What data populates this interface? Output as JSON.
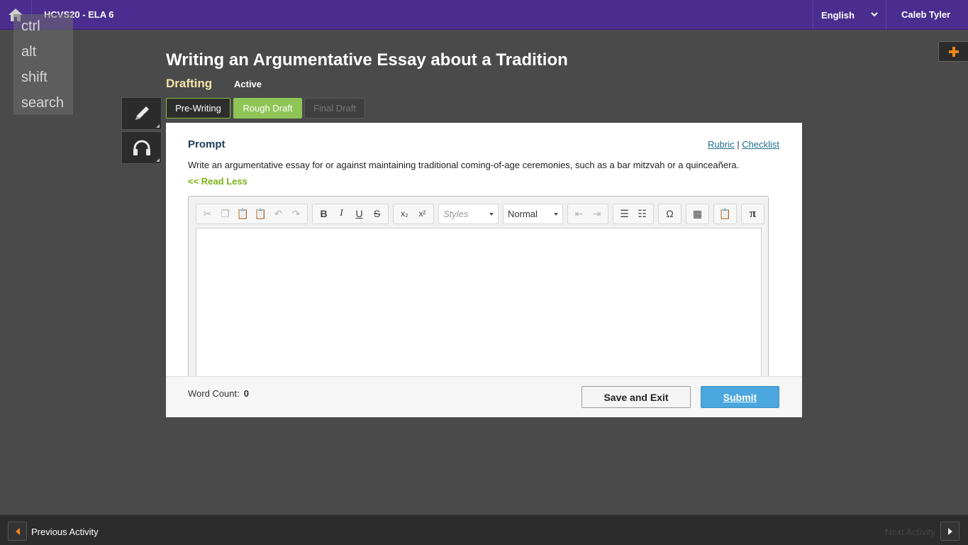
{
  "header": {
    "course_title": "HCVS20 - ELA 6",
    "language": "English",
    "user_name": "Caleb Tyler"
  },
  "keyboard_overlay": [
    "ctrl",
    "alt",
    "shift",
    "search"
  ],
  "activity": {
    "title": "Writing an Argumentative Essay about a Tradition",
    "step": "Drafting",
    "status": "Active"
  },
  "tabs": [
    {
      "label": "Pre-Writing",
      "state": "default"
    },
    {
      "label": "Rough Draft",
      "state": "selected"
    },
    {
      "label": "Final Draft",
      "state": "disabled"
    }
  ],
  "prompt": {
    "label": "Prompt",
    "rubric_link": "Rubric",
    "separator": "|",
    "checklist_link": "Checklist",
    "text": "Write an argumentative essay for or against maintaining traditional coming-of-age ceremonies, such as a bar mitzvah or a quinceañera.",
    "read_less": "<< Read Less"
  },
  "editor": {
    "styles_placeholder": "Styles",
    "format_value": "Normal",
    "content": ""
  },
  "footer": {
    "word_count_label": "Word Count:",
    "word_count_value": "0",
    "save_exit_label": "Save and Exit",
    "submit_label": "Submit"
  },
  "nav": {
    "previous_label": "Previous Activity",
    "next_label": "Next Activity"
  },
  "colors": {
    "topbar": "#4b2d8f",
    "accent_green": "#8fc556",
    "submit_blue": "#4ba7de",
    "background": "#4a4a4a"
  }
}
